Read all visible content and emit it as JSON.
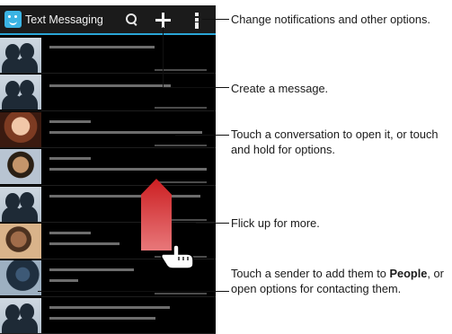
{
  "app": {
    "title": "Text Messaging"
  },
  "icons": {
    "app": "text-messaging-app-icon",
    "search": "search-icon",
    "compose": "compose-plus-icon",
    "menu": "overflow-menu-icon",
    "flick": "hand-pointer-icon"
  },
  "conversations": [
    {
      "avatar": "default"
    },
    {
      "avatar": "default"
    },
    {
      "avatar": "photo"
    },
    {
      "avatar": "photo"
    },
    {
      "avatar": "default"
    },
    {
      "avatar": "photo"
    },
    {
      "avatar": "photo"
    },
    {
      "avatar": "default"
    }
  ],
  "callouts": {
    "menu": "Change notifications and other options.",
    "compose": "Create a message.",
    "conversation": "Touch a conversation to open it, or touch and hold for options.",
    "flick": "Flick up for more.",
    "sender_before": "Touch a sender to add them to ",
    "sender_bold": "People",
    "sender_after": ", or open options for contacting them."
  },
  "colors": {
    "accent": "#2aa5d6",
    "scroll_arrow": "#cc1f22"
  }
}
